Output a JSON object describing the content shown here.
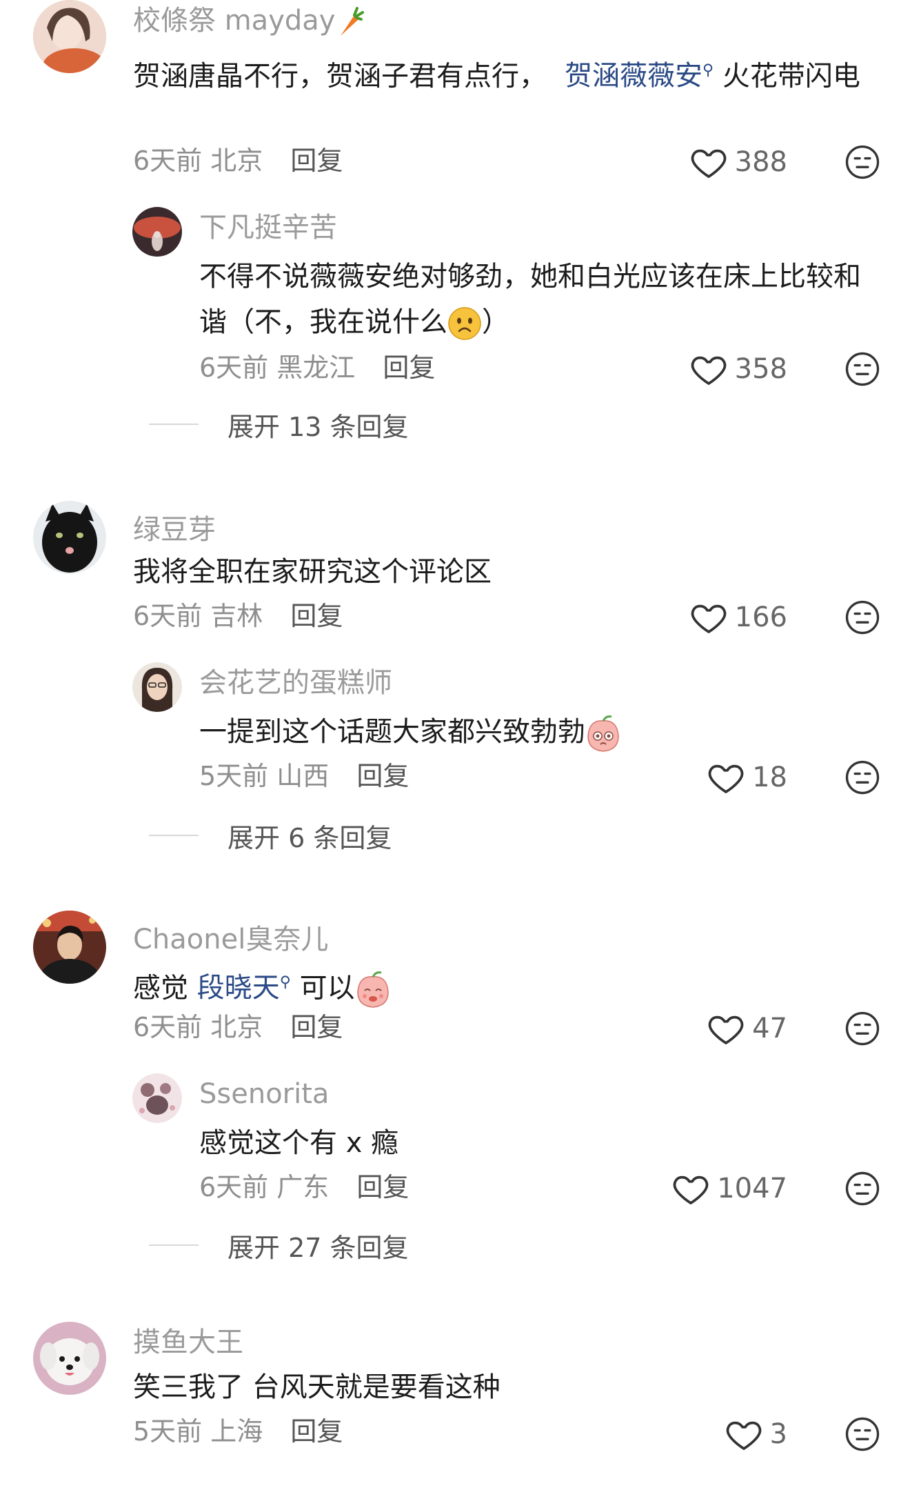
{
  "comments": [
    {
      "username": "校條祭 mayday",
      "text_before_link": "贺涵唐晶不行，贺涵子君有点行，",
      "link_text": "贺涵薇薇安",
      "text_after_link": "火花带闪电",
      "time": "6天前",
      "location": "北京",
      "reply_label": "回复",
      "likes": "388",
      "reply": {
        "username": "下凡挺辛苦",
        "text_before_emoji": "不得不说薇薇安绝对够劲，她和白光应该在床上比较和谐（不，我在说什么",
        "text_after_emoji": "）",
        "time": "6天前",
        "location": "黑龙江",
        "reply_label": "回复",
        "likes": "358"
      },
      "expand_label": "展开 13 条回复"
    },
    {
      "username": "绿豆芽",
      "text": "我将全职在家研究这个评论区",
      "time": "6天前",
      "location": "吉林",
      "reply_label": "回复",
      "likes": "166",
      "reply": {
        "username": "会花艺的蛋糕师",
        "text": "一提到这个话题大家都兴致勃勃",
        "time": "5天前",
        "location": "山西",
        "reply_label": "回复",
        "likes": "18"
      },
      "expand_label": "展开 6 条回复"
    },
    {
      "username": "Chaonel臭奈儿",
      "text_before_link": "感觉",
      "link_text": "段晓天",
      "text_after_link": "可以",
      "time": "6天前",
      "location": "北京",
      "reply_label": "回复",
      "likes": "47",
      "reply": {
        "username": "Ssenorita",
        "text": "感觉这个有 x 瘾",
        "time": "6天前",
        "location": "广东",
        "reply_label": "回复",
        "likes": "1047"
      },
      "expand_label": "展开 27 条回复"
    },
    {
      "username": "摸鱼大王",
      "text": "笑三我了 台风天就是要看这种",
      "time": "5天前",
      "location": "上海",
      "reply_label": "回复",
      "likes": "3"
    }
  ],
  "colors": {
    "username": "#9a9a9a",
    "link": "#2b4a86",
    "meta": "#8e8e8e"
  },
  "icons": [
    "heart-outline-icon",
    "dislike-face-icon",
    "carrot-icon",
    "worried-face-emoji",
    "peach-emoji",
    "search-icon"
  ]
}
